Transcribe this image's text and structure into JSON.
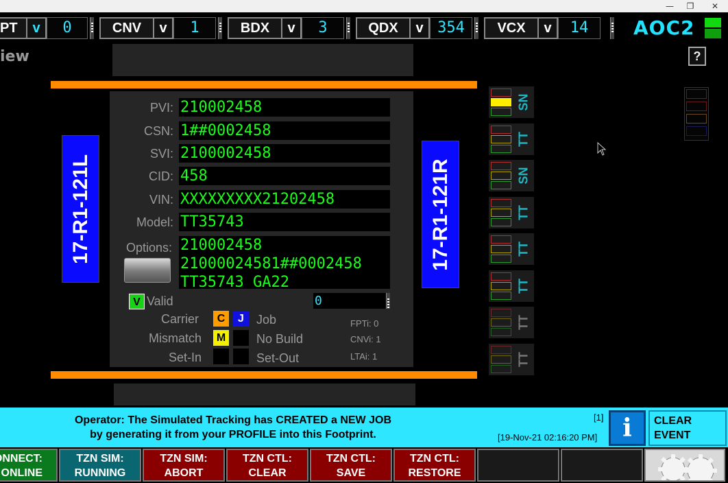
{
  "window": {
    "controls": [
      "—",
      "❐",
      "✕"
    ]
  },
  "topbar": {
    "counters": [
      {
        "label": "PT",
        "v": "v",
        "value": "0"
      },
      {
        "label": "CNV",
        "v": "v",
        "value": "1"
      },
      {
        "label": "BDX",
        "v": "v",
        "value": "3"
      },
      {
        "label": "QDX",
        "v": "v",
        "value": "354"
      },
      {
        "label": "VCX",
        "v": "v",
        "value": "14"
      }
    ],
    "app_name": "AOC2"
  },
  "view_label": "iew",
  "help_label": "?",
  "left_location": "17-R1-121L",
  "right_location": "17-R1-121R",
  "fields": [
    {
      "label": "PVI:",
      "value": "210002458"
    },
    {
      "label": "CSN:",
      "value": "1##0002458"
    },
    {
      "label": "SVI:",
      "value": "2100002458"
    },
    {
      "label": "CID:",
      "value": "458"
    },
    {
      "label": "VIN:",
      "value": "XXXXXXXXX21202458"
    },
    {
      "label": "Model:",
      "value": "TT35743"
    }
  ],
  "options": {
    "label": "Options:",
    "lines": [
      "210002458",
      "21000024581##0002458",
      "TT35743 GA22"
    ]
  },
  "valid": {
    "flag": "V",
    "label": "Valid",
    "value": "0"
  },
  "status": {
    "carrier_label": "Carrier",
    "carrier_flag": "C",
    "job_flag": "J",
    "job_label": "Job",
    "mismatch_label": "Mismatch",
    "mismatch_flag": "M",
    "nobuild_label": "No Build",
    "setin_label": "Set-In",
    "setout_label": "Set-Out"
  },
  "counters_info": {
    "fpti": "FPTi: 0",
    "cnvi": "CNVi: 1",
    "ltai": "LTAi: 1"
  },
  "tiles": [
    {
      "label": "SN",
      "active": true,
      "highlight": true
    },
    {
      "label": "TT",
      "active": true,
      "highlight": false
    },
    {
      "label": "SN",
      "active": true,
      "highlight": false
    },
    {
      "label": "TT",
      "active": true,
      "highlight": false
    },
    {
      "label": "TT",
      "active": true,
      "highlight": false
    },
    {
      "label": "TT",
      "active": true,
      "highlight": false
    },
    {
      "label": "TT",
      "active": false,
      "highlight": false
    },
    {
      "label": "TT",
      "active": false,
      "highlight": false
    }
  ],
  "message": {
    "line1": "Operator: The Simulated Tracking has CREATED a NEW JOB",
    "line2": "by generating it from your PROFILE into this Footprint.",
    "count": "[1]",
    "timestamp": "[19-Nov-21 02:16:20 PM]",
    "info_icon": "i",
    "clear_line1": "CLEAR",
    "clear_line2": "EVENT"
  },
  "buttons": [
    {
      "line1": "ONNECT:",
      "line2": "ONLINE",
      "color": "#0b7a1f"
    },
    {
      "line1": "TZN SIM:",
      "line2": "RUNNING",
      "color": "#0a6670"
    },
    {
      "line1": "TZN SIM:",
      "line2": "ABORT",
      "color": "#8a0000"
    },
    {
      "line1": "TZN CTL:",
      "line2": "CLEAR",
      "color": "#8a0000"
    },
    {
      "line1": "TZN CTL:",
      "line2": "SAVE",
      "color": "#8a0000"
    },
    {
      "line1": "TZN CTL:",
      "line2": "RESTORE",
      "color": "#8a0000"
    },
    {
      "line1": "",
      "line2": "",
      "color": "#1a1a1a"
    },
    {
      "line1": "",
      "line2": "",
      "color": "#1a1a1a"
    }
  ],
  "colors": {
    "cyan": "#2ee6ff",
    "accent_orange": "#ff8c00",
    "field_green": "#19ff19"
  }
}
